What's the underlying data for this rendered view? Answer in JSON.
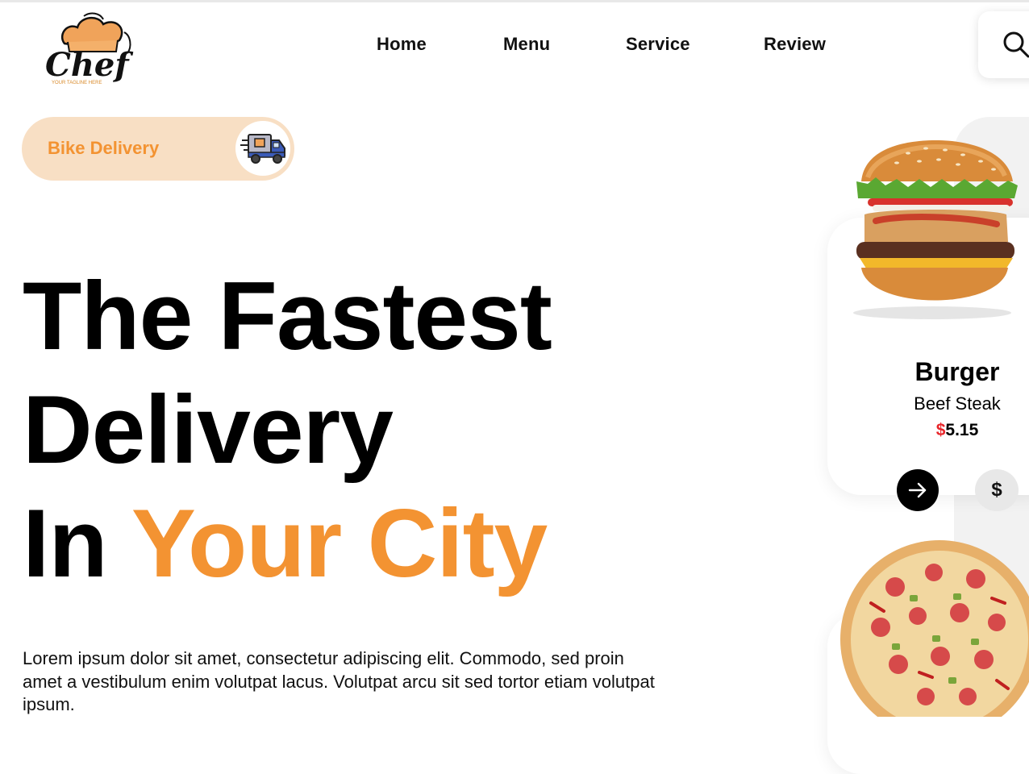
{
  "brand": {
    "logo_text": "Chef",
    "tagline": "YOUR TAGLINE HERE",
    "accent_color": "#f39332",
    "price_color": "#e8262b"
  },
  "nav": {
    "items": [
      {
        "label": "Home"
      },
      {
        "label": "Menu"
      },
      {
        "label": "Service"
      },
      {
        "label": "Review"
      }
    ],
    "search_icon": "search-icon"
  },
  "hero": {
    "badge_label": "Bike Delivery",
    "badge_icon": "delivery-truck-icon",
    "headline_line1": "The Fastest",
    "headline_line2": "Delivery",
    "headline_line3_plain": "In",
    "headline_line3_accent": "Your City",
    "description": "Lorem ipsum dolor sit amet, consectetur adipiscing elit. Commodo, sed proin amet a vestibulum enim volutpat lacus. Volutpat arcu sit sed tortor etiam volutpat ipsum."
  },
  "food_cards": [
    {
      "image": "burger-image",
      "title": "Burger",
      "subtitle": "Beef Steak",
      "currency": "$",
      "price": "5.15",
      "arrow_icon": "arrow-right-icon",
      "dollar_label": "$"
    },
    {
      "image": "pizza-image"
    }
  ]
}
